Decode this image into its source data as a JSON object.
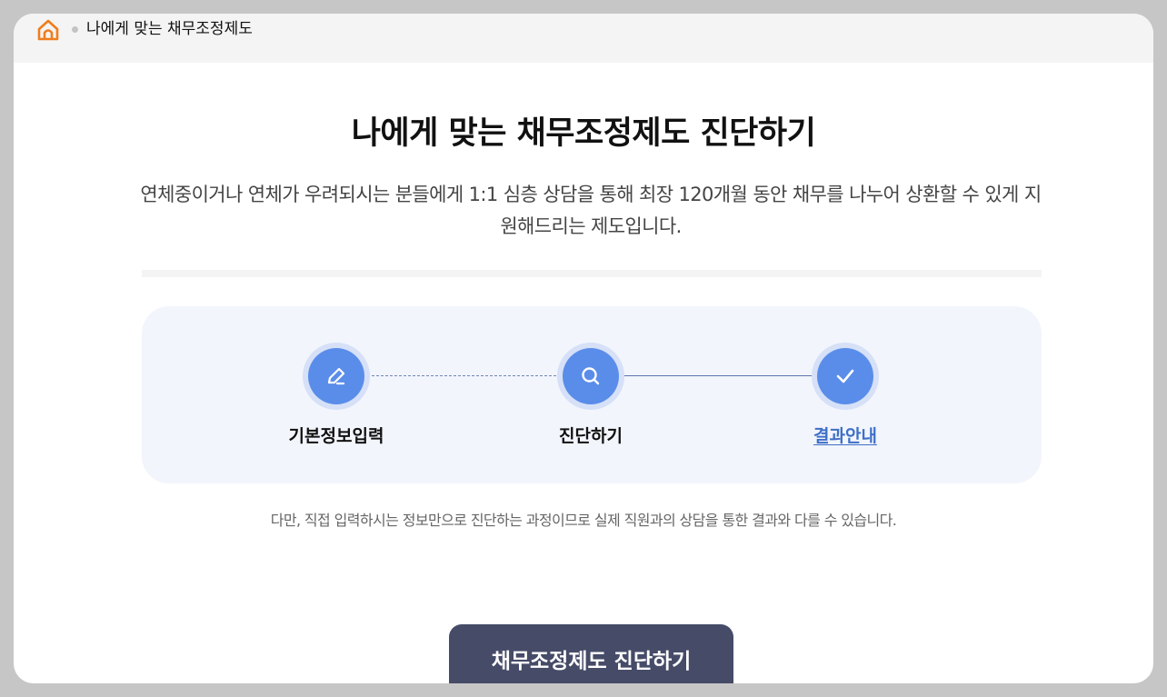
{
  "breadcrumb": {
    "home_icon": "home-icon",
    "current": "나에게 맞는 채무조정제도"
  },
  "main": {
    "title": "나에게 맞는 채무조정제도 진단하기",
    "description": "연체중이거나 연체가 우려되시는 분들에게 1:1 심층 상담을 통해 최장 120개월 동안 채무를 나누어 상환할 수 있게 지원해드리는 제도입니다."
  },
  "steps": [
    {
      "label": "기본정보입력",
      "icon": "pencil-icon",
      "active": false
    },
    {
      "label": "진단하기",
      "icon": "search-icon",
      "active": false
    },
    {
      "label": "결과안내",
      "icon": "check-icon",
      "active": true
    }
  ],
  "notice": "다만, 직접 입력하시는 정보만으로 진단하는 과정이므로 실제 직원과의 상담을 통한 결과와 다를 수 있습니다.",
  "cta": {
    "label": "채무조정제도 진단하기"
  },
  "colors": {
    "accent": "#5a8dea",
    "home_icon": "#f07d1c",
    "cta_bg": "#464b68",
    "active_link": "#3e6fc6"
  }
}
